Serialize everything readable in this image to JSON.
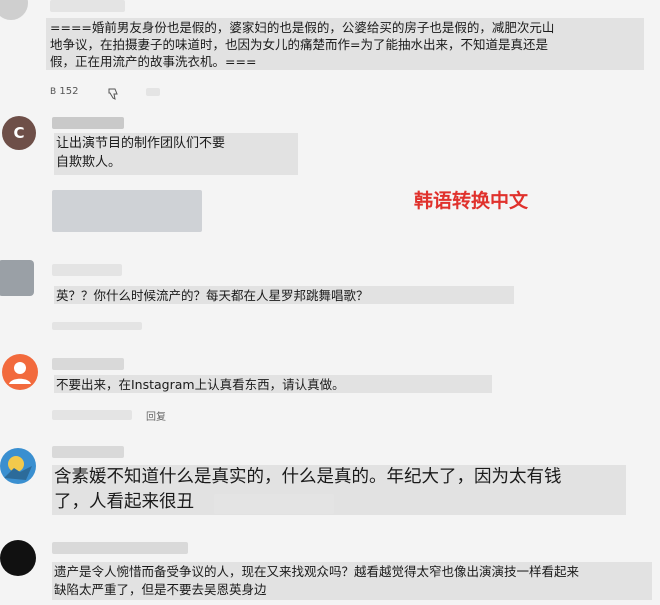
{
  "comments": [
    {
      "lines": [
        "====婚前男友身份也是假的，婆家妇的也是假的，公婆给买的房子也是假的，减肥次元山",
        "地争议，在拍摄妻子的味道时，也因为女儿的痛楚而作=为了能抽水出来，不知道是真还是",
        "假，正在用流产的故事洗衣机。==="
      ],
      "like_count": "152"
    },
    {
      "avatar_letter": "C",
      "lines": [
        "让出演节目的制作团队们不要",
        "自欺欺人。"
      ]
    },
    {
      "lines": [
        "英？？你什么时候流产的？每天都在人星罗邦跳舞唱歌？"
      ]
    },
    {
      "lines": [
        "不要出来，在Instagram上认真看东西，请认真做。"
      ],
      "reply_label": "回复"
    },
    {
      "lines": [
        "含素媛不知道什么是真实的，什么是真的。年纪大了，因为太有钱",
        "了，人看起来很丑"
      ]
    },
    {
      "lines": [
        "遗产是令人惋惜而备受争议的人，现在又来找观众吗？越看越觉得太窄也像出演演技一样看起来",
        "缺陷太严重了，但是不要去吴恩英身边"
      ]
    }
  ],
  "annotation": {
    "text": "韩语转换中文",
    "color": "#e0312c"
  },
  "colors": {
    "avatar_c": "#6e4f48",
    "avatar_orange": "#f26a3d",
    "avatar_blue": "#3a8fd0"
  }
}
